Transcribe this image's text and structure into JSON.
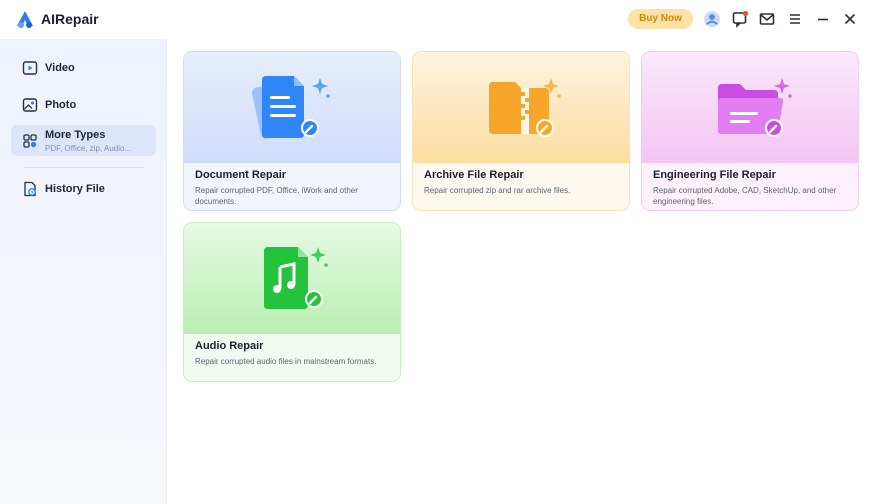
{
  "app": {
    "title": "AIRepair"
  },
  "header": {
    "buy_now_label": "Buy Now"
  },
  "sidebar": {
    "items": [
      {
        "label": "Video"
      },
      {
        "label": "Photo"
      },
      {
        "label": "More Types",
        "sublabel": "PDF, Office, zip, Audio..."
      },
      {
        "label": "History File"
      }
    ]
  },
  "cards": [
    {
      "title": "Document Repair",
      "description": "Repair corrupted PDF, Office, iWork and other documents."
    },
    {
      "title": "Archive File Repair",
      "description": "Repair corrupted zip and rar archive files."
    },
    {
      "title": "Engineering File Repair",
      "description": "Repair corrupted Adobe, CAD, SketchUp, and other engineering files."
    },
    {
      "title": "Audio Repair",
      "description": "Repair corrupted audio files in mainstream formats."
    }
  ],
  "colors": {
    "accent": "#2f7bf5",
    "buy_now_bg": "#fde2a7",
    "buy_now_text": "#c78a0a",
    "notification_dot": "#f04a3a"
  },
  "icons": {
    "header": [
      "account-icon",
      "notification-icon",
      "mail-icon",
      "menu-icon",
      "minimize-icon",
      "close-icon"
    ],
    "sidebar": [
      "video-icon",
      "photo-icon",
      "more-types-icon",
      "history-file-icon"
    ]
  }
}
